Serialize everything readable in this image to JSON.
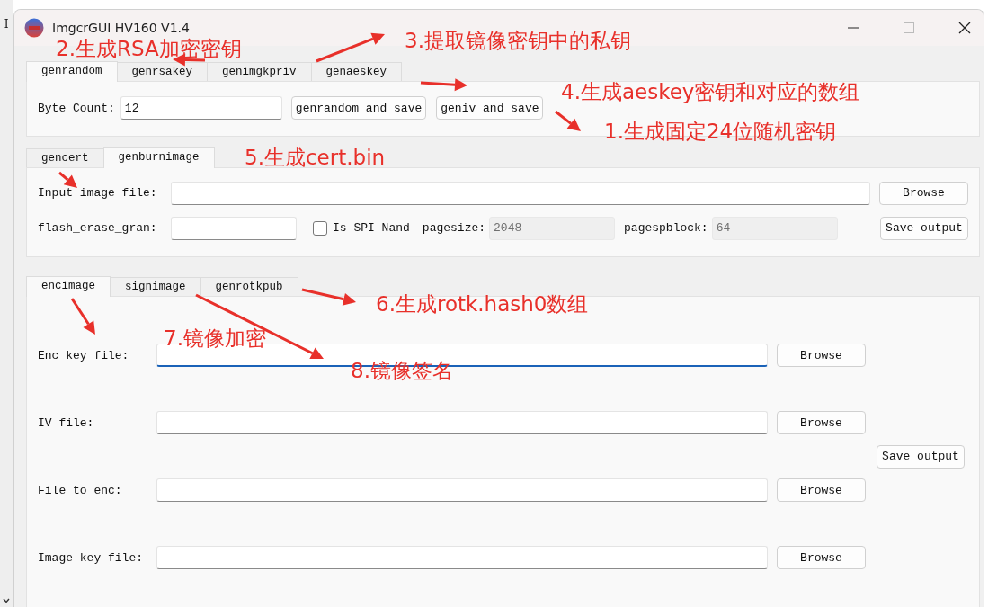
{
  "background_text": "I",
  "window": {
    "title": "ImgcrGUI HV160 V1.4"
  },
  "key_tools": {
    "tabs": [
      {
        "label": "genrandom",
        "selected": true
      },
      {
        "label": "genrsakey",
        "selected": false
      },
      {
        "label": "genimgkpriv",
        "selected": false
      },
      {
        "label": "genaeskey",
        "selected": false
      }
    ],
    "byte_count": {
      "label": "Byte Count:",
      "value": "12"
    },
    "buttons": [
      "genrandom and save",
      "geniv and save"
    ]
  },
  "burn_tools": {
    "tabs": [
      {
        "label": "gencert",
        "selected": false
      },
      {
        "label": "genburnimage",
        "selected": true
      }
    ],
    "input_image": {
      "label": "Input image file:",
      "button": "Browse"
    },
    "flash_erase": {
      "label": "flash_erase_gran:"
    },
    "spi_nand": {
      "label": "Is SPI Nand",
      "checked": false
    },
    "pagesize": {
      "label": "pagesize:",
      "value": "2048",
      "disabled": true
    },
    "pagespblock": {
      "label": "pagespblock:",
      "value": "64",
      "disabled": true
    },
    "save_button": "Save output"
  },
  "image_tools": {
    "tabs": [
      {
        "label": "encimage",
        "selected": true
      },
      {
        "label": "signimage",
        "selected": false
      },
      {
        "label": "genrotkpub",
        "selected": false
      }
    ],
    "rows": [
      {
        "label": "Enc key file:",
        "button": "Browse",
        "focused": true
      },
      {
        "label": "IV file:",
        "button": "Browse",
        "focused": false
      },
      {
        "label": "File to enc:",
        "button": "Browse",
        "focused": false
      },
      {
        "label": "Image key file:",
        "button": "Browse",
        "focused": false
      }
    ],
    "save_button": "Save output"
  },
  "annotations": [
    {
      "text": "2.生成RSA加密密钥"
    },
    {
      "text": "3.提取镜像密钥中的私钥"
    },
    {
      "text": "4.生成aeskey密钥和对应的数组"
    },
    {
      "text": "1.生成固定24位随机密钥"
    },
    {
      "text": "5.生成cert.bin"
    },
    {
      "text": "6.生成rotk.hash0数组"
    },
    {
      "text": "7.镜像加密"
    },
    {
      "text": "8.镜像签名"
    }
  ]
}
